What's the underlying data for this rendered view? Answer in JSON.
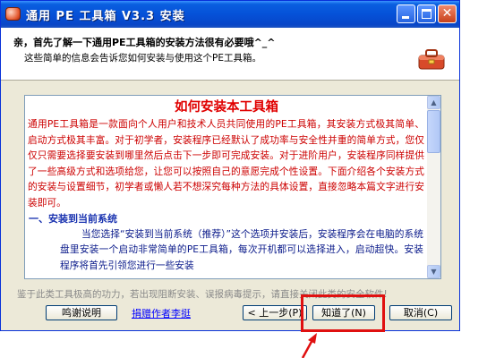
{
  "window": {
    "title": "通用 PE 工具箱 V3.3 安装",
    "icon": "toolbox-icon"
  },
  "header": {
    "title": "亲，首先了解一下通用PE工具箱的安装方法很有必要哦^_^",
    "subtitle": "这些简单的信息会告诉您如何安装与使用这个PE工具箱。"
  },
  "document": {
    "title": "如何安装本工具箱",
    "intro": "通用PE工具箱是一款面向个人用户和技术人员共同使用的PE工具箱，其安装方式极其简单、启动方式极其丰富。对于初学者，安装程序已经默认了成功率与安全性并重的简单方式，您仅仅只需要选择要安装到哪里然后点击下一步即可完成安装。对于进阶用户，安装程序同样提供了一些高级方式和选项给您，让您可以按照自己的意愿完成个性设置。下面介绍各个安装方式的安装与设置细节，初学者或懒人若不想深究每种方法的具体设置，直接忽略本篇文字进行安装即可。",
    "section1": "一、安装到当前系统",
    "section1_text": "当您选择“安装到当前系统（推荐）”这个选项并安装后，安装程序会在电脑的系统盘里安装一个启动非常简单的PE工具箱，每次开机都可以选择进入，启动超快。安装程序将首先引领您进行一些安装"
  },
  "footer": {
    "tagline": "鉴于此类工具极高的功力，若出现阻断安装、误报病毒提示，请直接关闭此类的安全软件!",
    "thanks_button": "鸣谢说明",
    "author_link": "捐赠作者李挺",
    "back_button": "< 上一步(P)",
    "agree_button": "知道了(N)",
    "cancel_button": "取消(C)"
  },
  "colors": {
    "title_bar": "#0551d8",
    "doc_text": "#cc0000",
    "section_text": "#1a33b0",
    "highlight": "#e01010"
  }
}
